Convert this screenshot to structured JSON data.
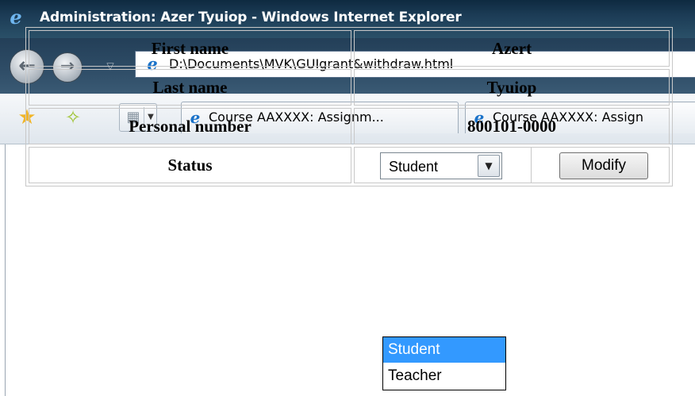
{
  "window": {
    "title": "Administration: Azer Tyuiop - Windows Internet Explorer"
  },
  "navigation": {
    "address": "D:\\Documents\\MVK\\GUIgrant&withdraw.html"
  },
  "tabs": [
    {
      "label": "Course AAXXXX: Assignm...",
      "active": false
    },
    {
      "label": "Course AAXXXX: Assign",
      "active": false
    }
  ],
  "icons": {
    "ie": "internet-explorer-icon",
    "back": "back-arrow-icon",
    "forward": "forward-arrow-icon",
    "favorites": "favorites-star-icon",
    "add_favorites": "add-favorites-icon",
    "quick_tabs": "quick-tabs-icon"
  },
  "form": {
    "rows": [
      {
        "label": "First name",
        "value": "Azert"
      },
      {
        "label": "Last name",
        "value": "Tyuiop"
      },
      {
        "label": "Personal number",
        "value": "800101-0000"
      }
    ],
    "status": {
      "label": "Status",
      "selected": "Student",
      "options": [
        "Student",
        "Teacher"
      ],
      "highlighted": "Student"
    },
    "modify_label": "Modify"
  },
  "colors": {
    "highlight": "#3399ff",
    "titlebar": "#1c3c56"
  }
}
